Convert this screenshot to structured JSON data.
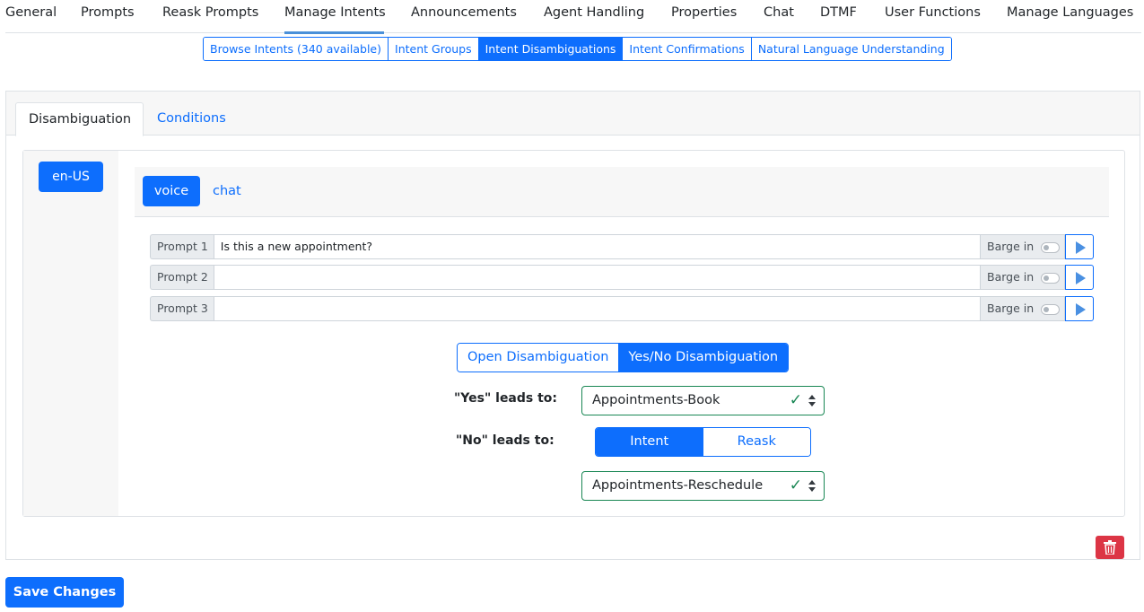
{
  "top_nav": {
    "items": [
      {
        "label": "General"
      },
      {
        "label": "Prompts"
      },
      {
        "label": "Reask Prompts"
      },
      {
        "label": "Manage Intents"
      },
      {
        "label": "Announcements"
      },
      {
        "label": "Agent Handling"
      },
      {
        "label": "Properties"
      },
      {
        "label": "Chat"
      },
      {
        "label": "DTMF"
      },
      {
        "label": "User Functions"
      },
      {
        "label": "Manage Languages"
      }
    ],
    "active": "Manage Intents"
  },
  "sub_tabs": {
    "items": [
      {
        "label": "Browse Intents (340 available)"
      },
      {
        "label": "Intent Groups"
      },
      {
        "label": "Intent Disambiguations"
      },
      {
        "label": "Intent Confirmations"
      },
      {
        "label": "Natural Language Understanding"
      }
    ],
    "active": "Intent Disambiguations"
  },
  "panel_tabs": {
    "disambiguation": "Disambiguation",
    "conditions": "Conditions"
  },
  "language": "en-US",
  "channels": {
    "voice": "voice",
    "chat": "chat",
    "active": "voice"
  },
  "prompts": [
    {
      "label": "Prompt 1",
      "value": "Is this a new appointment?",
      "barge_label": "Barge in",
      "barge_on": false
    },
    {
      "label": "Prompt 2",
      "value": "",
      "barge_label": "Barge in",
      "barge_on": false
    },
    {
      "label": "Prompt 3",
      "value": "",
      "barge_label": "Barge in",
      "barge_on": false
    }
  ],
  "mode": {
    "open": "Open Disambiguation",
    "yesno": "Yes/No Disambiguation",
    "active": "Yes/No Disambiguation"
  },
  "yes": {
    "label": "\"Yes\" leads to:",
    "value": "Appointments-Book"
  },
  "no": {
    "label": "\"No\" leads to:",
    "intent": "Intent",
    "reask": "Reask",
    "active": "Intent",
    "value": "Appointments-Reschedule"
  },
  "save_label": "Save Changes",
  "icons": {
    "delete": "trash-icon",
    "play": "play-icon",
    "valid": "check-icon",
    "select_caret": "sort-caret-icon"
  },
  "colors": {
    "primary": "#0d6efd",
    "danger": "#dc3545",
    "success": "#198754"
  }
}
